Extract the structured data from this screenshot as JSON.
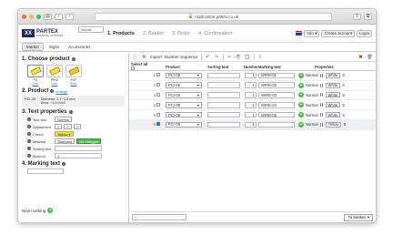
{
  "browser": {
    "url": "markonline.partex.co.uk"
  },
  "header": {
    "logo_mark": "XX",
    "logo_name": "PARTEX",
    "logo_sub": "MARKING SYSTEMS",
    "search_value": "Normal",
    "steps": [
      "1. Products",
      "2. Basket",
      "3. Order",
      "4. Confirmation"
    ],
    "info_label": "Info",
    "create_account": "Create account",
    "login": "Login"
  },
  "subtabs": [
    "Marker",
    "Signs",
    "Accessories"
  ],
  "left": {
    "choose_title": "1. Choose product",
    "products": [
      {
        "name": "PX",
        "dim": "Dim."
      },
      {
        "name": "PPGI",
        "dim": "Dim."
      },
      {
        "name": "PXF",
        "dim": "Dim."
      }
    ],
    "product_title": "2. Product",
    "change_link": "change",
    "product_code": "PCI-05",
    "product_diameter": "Diameter: 2,7~3,5 mm",
    "product_area": "Area: ~1,5 mm2",
    "text_title": "3. Text properties",
    "text_size_label": "Text size",
    "text_size_value": "Normal",
    "adjustment_label": "Adjustment",
    "colour_label": "Colour",
    "colour_value": "Yellow",
    "material_label": "Material",
    "material_value": "Standard",
    "halogen_value": "No Halogen",
    "sorting_label": "Sorting text",
    "amount_label": "Amount",
    "amount_value": "1",
    "marking_title": "4. Marking text",
    "new_marking": "New marking"
  },
  "toolbar": {
    "import": "Import",
    "number_sequence": "Number sequence"
  },
  "table": {
    "headers": {
      "select_all": "Select all",
      "product": "Product",
      "sorting": "Sorting text",
      "number": "Number",
      "marking": "Marking text",
      "properties": "Properties"
    },
    "rows": [
      {
        "idx": "1",
        "product": "PCI-05",
        "number": "1",
        "marking": "WIRE-01",
        "size": "Normal",
        "colour": "White",
        "selected": false
      },
      {
        "idx": "2",
        "product": "PCI-05",
        "number": "1",
        "marking": "WIRE-02",
        "size": "Normal",
        "colour": "White",
        "selected": false
      },
      {
        "idx": "3",
        "product": "PCI-05",
        "number": "1",
        "marking": "WIRE-03",
        "size": "Normal",
        "colour": "White",
        "selected": false
      },
      {
        "idx": "4",
        "product": "PCI-05",
        "number": "1",
        "marking": "WIRE-04",
        "size": "Normal",
        "colour": "White",
        "selected": false
      },
      {
        "idx": "5",
        "product": "PCI-05",
        "number": "1",
        "marking": "WIRE-05",
        "size": "Normal",
        "colour": "White",
        "selected": false
      },
      {
        "idx": "6",
        "product": "PCI-05",
        "number": "1",
        "marking": "",
        "size": "Normal",
        "colour": "Yellow",
        "selected": true
      }
    ]
  },
  "bottom": {
    "basket": "To basket"
  },
  "colors": {
    "accent_green": "#4cb848",
    "yellow": "#f5e700",
    "brand_navy": "#1e2c5a"
  }
}
